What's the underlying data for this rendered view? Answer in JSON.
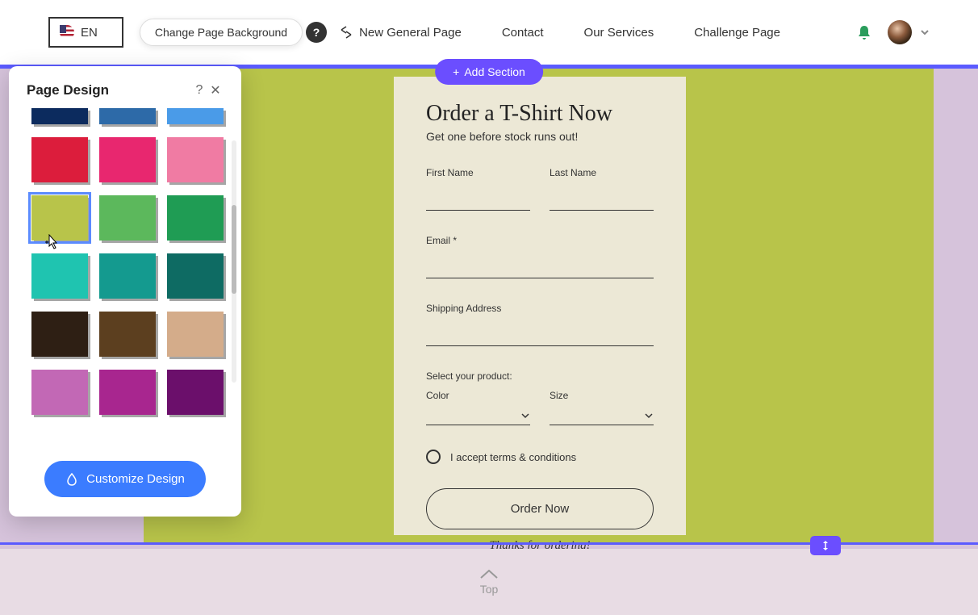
{
  "topnav": {
    "lang": "EN",
    "tooltip": "Change Page Background",
    "items": [
      "New General Page",
      "Contact",
      "Our Services",
      "Challenge Page"
    ]
  },
  "add_section_label": "Add Section",
  "form": {
    "title": "Order a T-Shirt Now",
    "subtitle": "Get one before stock runs out!",
    "first_name": "First Name",
    "last_name": "Last Name",
    "email": "Email *",
    "shipping": "Shipping Address",
    "select_prompt": "Select your product:",
    "color": "Color",
    "size": "Size",
    "terms": "I accept terms & conditions",
    "button": "Order Now",
    "thanks": "Thanks for ordering!"
  },
  "panel": {
    "title": "Page Design",
    "customize": "Customize Design",
    "swatches_top": [
      "#0c2b5e",
      "#2d6aa8",
      "#4a9be8"
    ],
    "swatch_rows": [
      [
        "#dc1d3c",
        "#e8276f",
        "#f07ba3"
      ],
      [
        "#b8c44a",
        "#5cb85c",
        "#1f9c54"
      ],
      [
        "#1fc4b0",
        "#149a8f",
        "#0e6b63"
      ],
      [
        "#2e1f14",
        "#5c3f1f",
        "#d4ac8a"
      ],
      [
        "#c268b5",
        "#a8268f",
        "#6b0f6b"
      ]
    ],
    "selected_index": [
      1,
      0
    ]
  },
  "footer": {
    "label": "Top"
  }
}
